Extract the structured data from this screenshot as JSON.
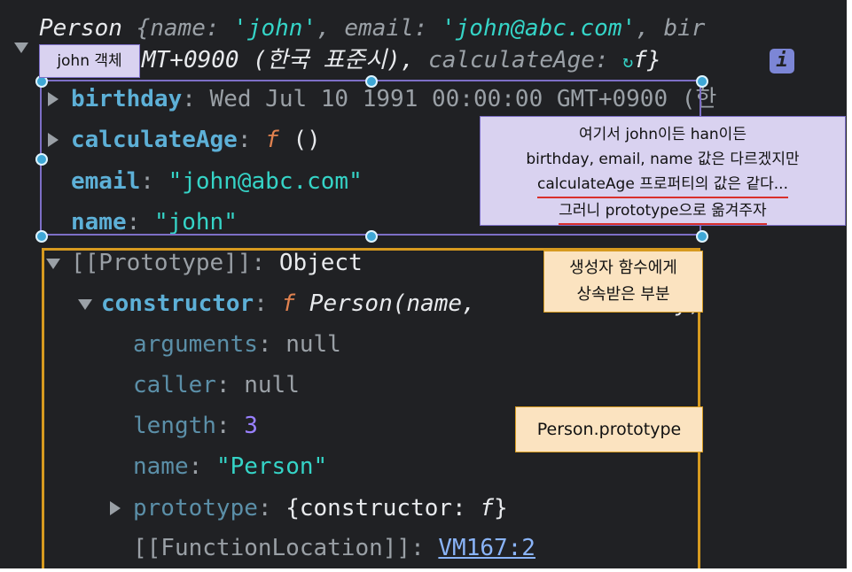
{
  "console": {
    "header": "Person {name: 'john', email: 'john@abc.com', bir",
    "header_parts": {
      "cls": "Person",
      "open": " {",
      "k1": "name",
      "v1": "'john'",
      "k2": "email",
      "v2": "'john@abc.com'",
      "k3": "bir"
    },
    "line2": {
      "pre": "MT+0900 (한국 표준시), ",
      "key": "calculateAge",
      "colon": ": ",
      "f": "f",
      "close": "}"
    },
    "info_label": "i",
    "birthday": {
      "key": "birthday",
      "value": "Wed Jul 10 1991 00:00:00 GMT+0900 (한"
    },
    "calculateAge": {
      "key": "calculateAge",
      "value": "()",
      "f": "f"
    },
    "email": {
      "key": "email",
      "value": "\"john@abc.com\""
    },
    "name": {
      "key": "name",
      "value": "\"john\""
    },
    "prototype": {
      "label": "[[Prototype]]",
      "value": "Object"
    },
    "constructor": {
      "key": "constructor",
      "f": "f",
      "value": "Person(name,",
      "tail": "birthday)"
    },
    "arguments": {
      "key": "arguments",
      "value": "null"
    },
    "caller": {
      "key": "caller",
      "value": "null"
    },
    "length": {
      "key": "length",
      "value": "3"
    },
    "fname": {
      "key": "name",
      "value": "\"Person\""
    },
    "proto2": {
      "key": "prototype",
      "open": "{constructor: ",
      "f": "f",
      "close": "}"
    },
    "fnloc": {
      "label": "[[FunctionLocation]]",
      "link": "VM167:2"
    }
  },
  "annotations": {
    "john_label": "john 객체",
    "explain": [
      "여기서 john이든 han이든",
      "birthday, email, name 값은 다르겠지만",
      "calculateAge 프로퍼티의 값은 같다...",
      "그러니 prototype으로 옮겨주자"
    ],
    "inherited": [
      "생성자 함수에게",
      "상속받은 부분"
    ],
    "person_proto": "Person.prototype"
  },
  "colors": {
    "background": "#202124",
    "key": "#5db0d7",
    "string": "#35d4c7",
    "function": "#e2824f",
    "number": "#9980ff",
    "selection": "#7d6fc7",
    "prototype_box": "#d69a1f"
  }
}
